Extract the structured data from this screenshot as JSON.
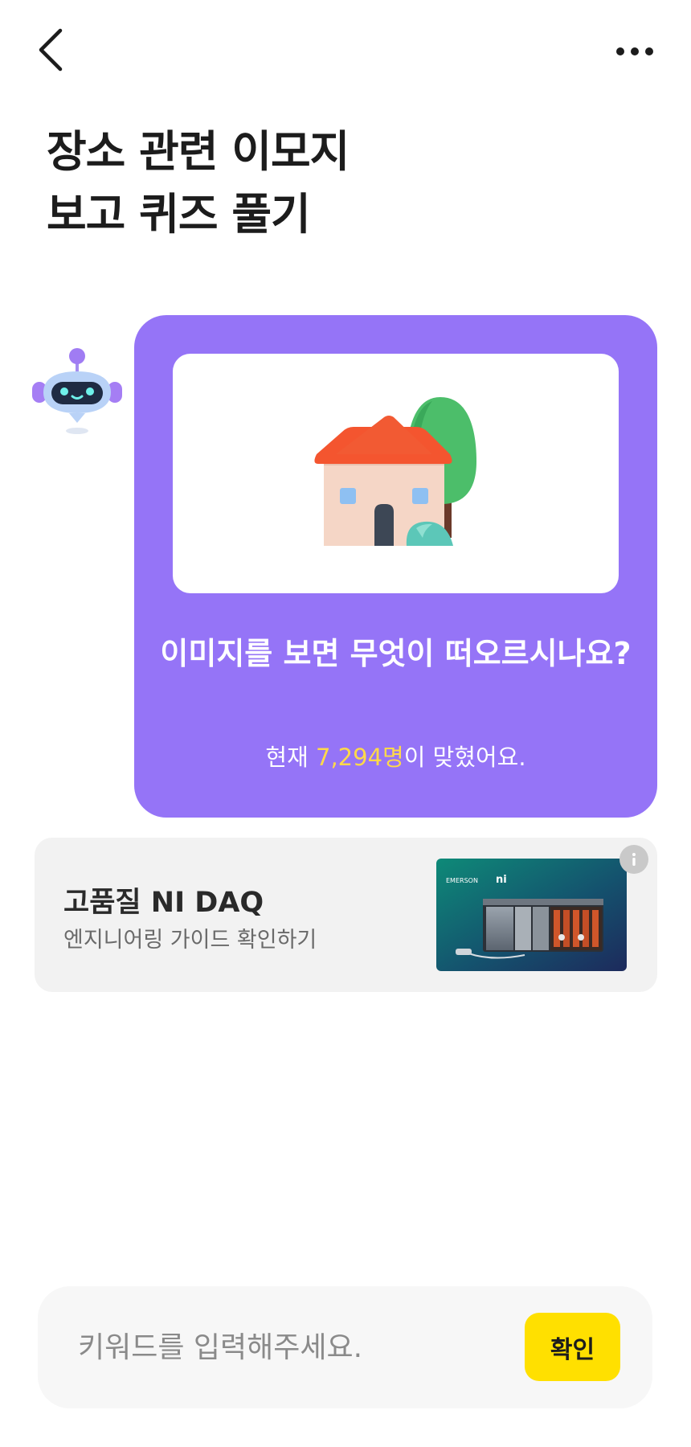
{
  "header": {
    "back_icon": "chevron-left-icon",
    "more_icon": "more-horizontal-icon"
  },
  "title": {
    "line1": "장소 관련 이모지",
    "line2": "보고 퀴즈 풀기"
  },
  "quiz": {
    "bot_icon": "robot-icon",
    "emoji_icon": "house-with-tree-emoji",
    "question": "이미지를 보면 무엇이 떠오르시나요?",
    "stat_prefix": "현재 ",
    "stat_count": "7,294명",
    "stat_suffix": "이 맞혔어요.",
    "colors": {
      "card": "#9574f7",
      "highlight": "#ffd94a"
    }
  },
  "ad": {
    "title": "고품질 NI DAQ",
    "subtitle": "엔지니어링 가이드 확인하기",
    "brand_left": "EMERSON",
    "brand_right": "ni",
    "info_icon": "info-icon"
  },
  "input": {
    "placeholder": "키워드를 입력해주세요.",
    "value": "",
    "confirm_label": "확인",
    "colors": {
      "button": "#ffe000"
    }
  }
}
